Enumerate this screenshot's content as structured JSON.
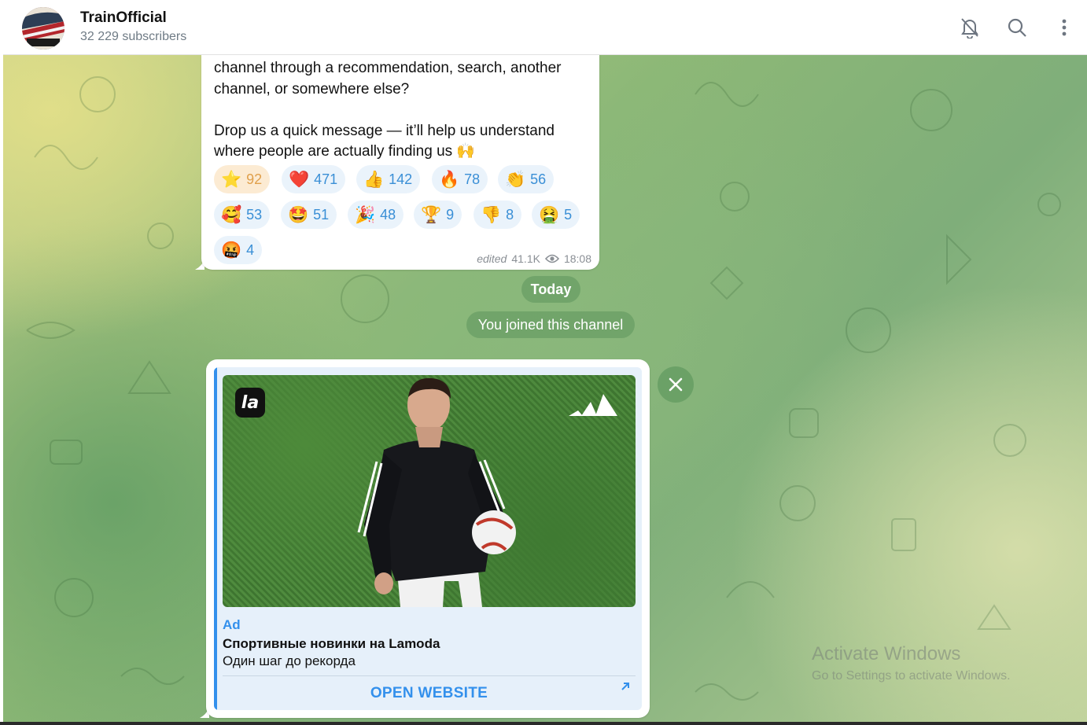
{
  "header": {
    "title": "TrainOfficial",
    "subtitle": "32 229 subscribers",
    "icons": [
      "bell-muted-icon",
      "search-icon",
      "more-vertical-icon"
    ]
  },
  "message": {
    "text": "channel through a recommendation, search, another\nchannel, or somewhere else?\n\nDrop us a quick message — it’ll help us understand\nwhere people are actually finding us 🙌",
    "reactions": [
      {
        "emoji": "⭐",
        "count": "92",
        "active": true
      },
      {
        "emoji": "❤️",
        "count": "471"
      },
      {
        "emoji": "👍",
        "count": "142"
      },
      {
        "emoji": "🔥",
        "count": "78"
      },
      {
        "emoji": "👏",
        "count": "56"
      },
      {
        "emoji": "🥰",
        "count": "53"
      },
      {
        "emoji": "🤩",
        "count": "51"
      },
      {
        "emoji": "🎉",
        "count": "48"
      },
      {
        "emoji": "🏆",
        "count": "9"
      },
      {
        "emoji": "👎",
        "count": "8"
      },
      {
        "emoji": "🤮",
        "count": "5"
      },
      {
        "emoji": "🤬",
        "count": "4"
      }
    ],
    "meta": {
      "edited": "edited",
      "views": "41.1K",
      "time": "18:08"
    }
  },
  "service": {
    "date": "Today",
    "joined": "You joined this channel"
  },
  "ad": {
    "label": "Ad",
    "title": "Спортивные новинки на Lamoda",
    "description": "Один шаг до рекорда",
    "button": "OPEN WEBSITE",
    "logo_text": "la"
  },
  "watermark": {
    "title": "Activate Windows",
    "subtitle": "Go to Settings to activate Windows."
  },
  "colors": {
    "accent": "#3390ec",
    "pill_bg": "#5c965c",
    "reaction_bg": "#eaf3fb",
    "reaction_active_bg": "#fcebd3"
  }
}
